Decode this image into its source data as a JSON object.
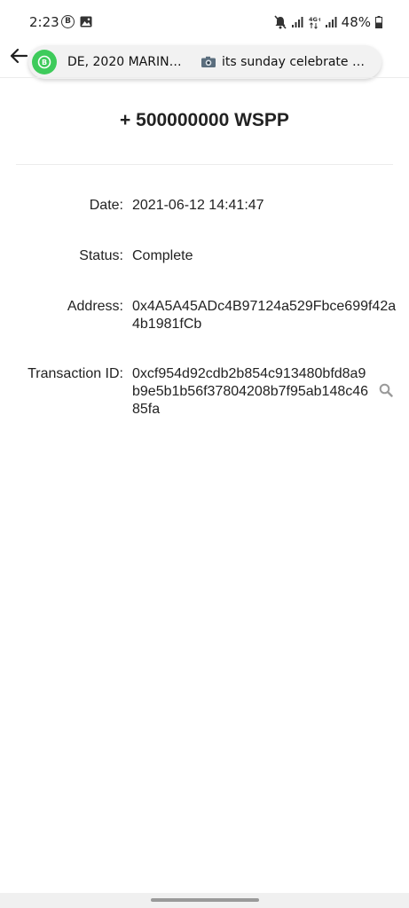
{
  "status_bar": {
    "time": "2:23",
    "battery": "48%",
    "icons": [
      "b-badge-icon",
      "image-icon",
      "mute-icon",
      "signal-icon",
      "4g-icon",
      "signal-icon-2",
      "battery-icon"
    ]
  },
  "notification": {
    "left_text": "DE, 2020 MARINE...",
    "right_text": "its sunday celebrate wi...",
    "app_icon": "whatsapp-icon"
  },
  "transaction": {
    "amount": "+ 500000000 WSPP",
    "date_label": "Date:",
    "date_value": "2021-06-12 14:41:47",
    "status_label": "Status:",
    "status_value": "Complete",
    "address_label": "Address:",
    "address_value": "0x4A5A45ADc4B97124a529Fbce699f42a4b1981fCb",
    "txid_label": "Transaction ID:",
    "txid_value": "0xcf954d92cdb2b854c913480bfd8a9b9e5b1b56f37804208b7f95ab148c4685fa"
  },
  "colors": {
    "whatsapp_green": "#3ecb5b",
    "text": "#222222",
    "divider": "#ececec"
  }
}
